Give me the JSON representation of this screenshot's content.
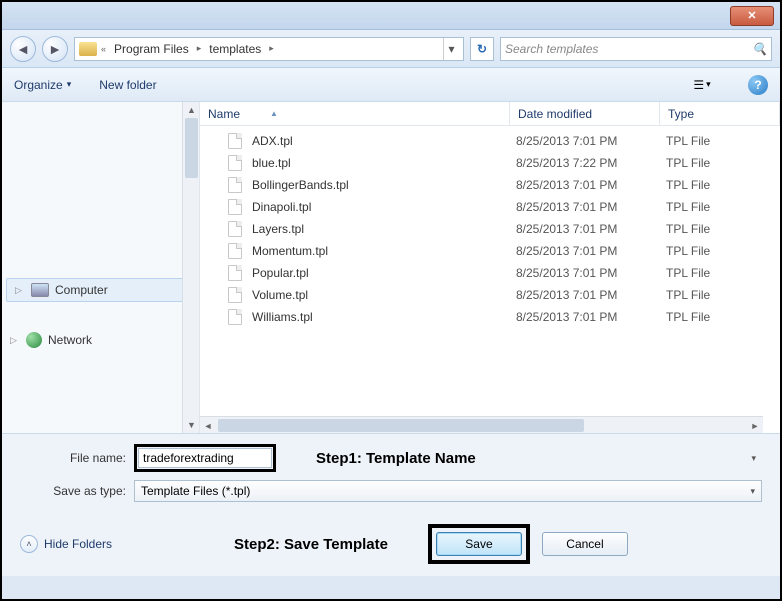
{
  "titlebar": {
    "close": "✕"
  },
  "nav": {
    "back": "◄",
    "forward": "►",
    "crumb_sep": "«",
    "crumb1": "Program Files",
    "arrow": "▸",
    "crumb2": "templates",
    "dropdown": "▾",
    "refresh": "↻",
    "search_placeholder": "Search templates",
    "search_icon": "🔍"
  },
  "toolbar": {
    "organize": "Organize",
    "organize_arrow": "▾",
    "newfolder": "New folder",
    "views_icon": "☰",
    "views_arrow": "▾",
    "help": "?"
  },
  "columns": {
    "name": "Name",
    "date": "Date modified",
    "type": "Type",
    "sort": "▲"
  },
  "tree": {
    "computer": "Computer",
    "network": "Network",
    "exp": "▷"
  },
  "files": [
    {
      "name": "ADX.tpl",
      "date": "8/25/2013 7:01 PM",
      "type": "TPL File"
    },
    {
      "name": "blue.tpl",
      "date": "8/25/2013 7:22 PM",
      "type": "TPL File"
    },
    {
      "name": "BollingerBands.tpl",
      "date": "8/25/2013 7:01 PM",
      "type": "TPL File"
    },
    {
      "name": "Dinapoli.tpl",
      "date": "8/25/2013 7:01 PM",
      "type": "TPL File"
    },
    {
      "name": "Layers.tpl",
      "date": "8/25/2013 7:01 PM",
      "type": "TPL File"
    },
    {
      "name": "Momentum.tpl",
      "date": "8/25/2013 7:01 PM",
      "type": "TPL File"
    },
    {
      "name": "Popular.tpl",
      "date": "8/25/2013 7:01 PM",
      "type": "TPL File"
    },
    {
      "name": "Volume.tpl",
      "date": "8/25/2013 7:01 PM",
      "type": "TPL File"
    },
    {
      "name": "Williams.tpl",
      "date": "8/25/2013 7:01 PM",
      "type": "TPL File"
    }
  ],
  "bottom": {
    "filename_label": "File name:",
    "filename_value": "tradeforextrading",
    "type_label": "Save as type:",
    "type_value": "Template Files (*.tpl)",
    "step1": "Step1: Template Name",
    "step2": "Step2: Save Template",
    "hide": "Hide Folders",
    "hide_icon": "˄",
    "save": "Save",
    "cancel": "Cancel",
    "drop": "▾"
  },
  "scroll": {
    "up": "▲",
    "down": "▼",
    "left": "◄",
    "right": "►"
  }
}
